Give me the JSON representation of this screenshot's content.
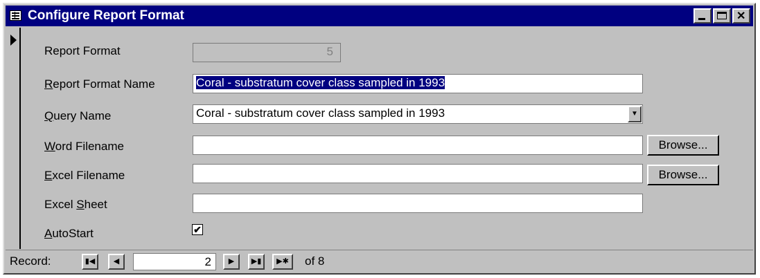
{
  "window": {
    "title": "Configure Report Format"
  },
  "icons": {
    "form": "form-icon",
    "minimize": "minimize-icon",
    "maximize": "maximize-icon",
    "close": "close-icon",
    "record_selector": "record-selector-arrow-icon",
    "dropdown": "chevron-down-icon",
    "first": "first-record-icon",
    "prev": "previous-record-icon",
    "next": "next-record-icon",
    "last": "last-record-icon",
    "new": "new-record-icon"
  },
  "form": {
    "report_format": {
      "label": "Report Format",
      "value": "5"
    },
    "report_format_name": {
      "label_pre": "",
      "label_ul": "R",
      "label_post": "eport Format Name",
      "value": "Coral - substratum cover class sampled in 1993"
    },
    "query_name": {
      "label_pre": "",
      "label_ul": "Q",
      "label_post": "uery Name",
      "value": "Coral - substratum cover class sampled in 1993"
    },
    "word_filename": {
      "label_pre": "",
      "label_ul": "W",
      "label_post": "ord Filename",
      "value": "",
      "browse": "Browse..."
    },
    "excel_filename": {
      "label_pre": "",
      "label_ul": "E",
      "label_post": "xcel Filename",
      "value": "",
      "browse": "Browse..."
    },
    "excel_sheet": {
      "label_pre": "Excel ",
      "label_ul": "S",
      "label_post": "heet",
      "value": ""
    },
    "autostart": {
      "label_pre": "",
      "label_ul": "A",
      "label_post": "utoStart",
      "checked": "✔"
    }
  },
  "record_nav": {
    "label": "Record:",
    "current": "2",
    "of_text": "of 8",
    "first": "▮◀",
    "prev": "◀",
    "next": "▶",
    "last": "▶▮",
    "new": "▶✱"
  },
  "colors": {
    "titlebar": "#000080",
    "face": "#c0c0c0",
    "selection": "#000080"
  }
}
